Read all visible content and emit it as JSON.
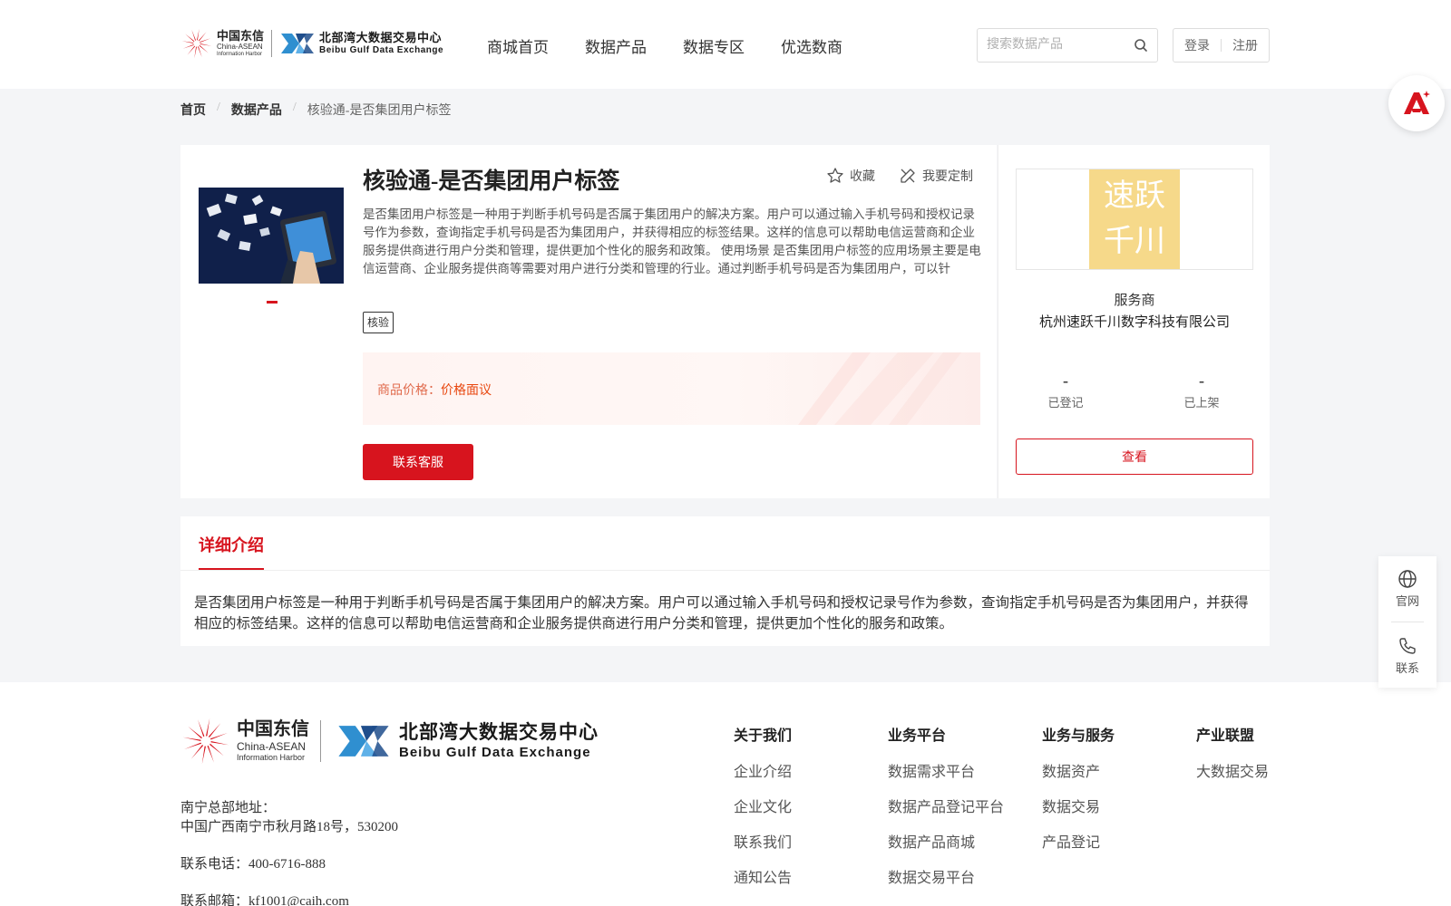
{
  "brand": {
    "ca_cn": "中国东信",
    "ca_en1": "China-ASEAN",
    "ca_en2": "Information Harbor",
    "bx_cn": "北部湾大数据交易中心",
    "bx_en": "Beibu Gulf Data Exchange",
    "primary_color": "#d7141e",
    "accent_blue": "#2f8fd0"
  },
  "nav": {
    "items": [
      "商城首页",
      "数据产品",
      "数据专区",
      "优选数商"
    ]
  },
  "search": {
    "placeholder": "搜索数据产品",
    "icon": "search-icon"
  },
  "auth": {
    "login": "登录",
    "register": "注册"
  },
  "breadcrumb": {
    "home": "首页",
    "category": "数据产品",
    "current": "核验通-是否集团用户标签"
  },
  "product": {
    "title": "核验通-是否集团用户标签",
    "favorite_label": "收藏",
    "customize_label": "我要定制",
    "description": "是否集团用户标签是一种用于判断手机号码是否属于集团用户的解决方案。用户可以通过输入手机号码和授权记录号作为参数，查询指定手机号码是否为集团用户，并获得相应的标签结果。这样的信息可以帮助电信运营商和企业服务提供商进行用户分类和管理，提供更加个性化的服务和政策。 使用场景 是否集团用户标签的应用场景主要是电信运营商、企业服务提供商等需要对用户进行分类和管理的行业。通过判断手机号码是否为集团用户，可以针",
    "tag": "核验",
    "price_label": "商品价格：",
    "price_value": "价格面议",
    "contact_button": "联系客服"
  },
  "provider": {
    "logo_text_line1": "速跃",
    "logo_text_line2": "千川",
    "label": "服务商",
    "name": "杭州速跃千川数字科技有限公司",
    "stats": [
      {
        "value": "-",
        "label": "已登记"
      },
      {
        "value": "-",
        "label": "已上架"
      }
    ],
    "view_button": "查看"
  },
  "detail": {
    "tab": "详细介绍",
    "text": "是否集团用户标签是一种用于判断手机号码是否属于集团用户的解决方案。用户可以通过输入手机号码和授权记录号作为参数，查询指定手机号码是否为集团用户，并获得相应的标签结果。这样的信息可以帮助电信运营商和企业服务提供商进行用户分类和管理，提供更加个性化的服务和政策。"
  },
  "side_widget": {
    "items": [
      {
        "label": "官网",
        "icon": "globe-icon"
      },
      {
        "label": "联系",
        "icon": "phone-icon"
      }
    ]
  },
  "footer": {
    "address_label": "南宁总部地址：",
    "address": "中国广西南宁市秋月路18号，530200",
    "phone": "联系电话：400-6716-888",
    "email": "联系邮箱：kf1001@caih.com",
    "columns": [
      {
        "title": "关于我们",
        "items": [
          "企业介绍",
          "企业文化",
          "联系我们",
          "通知公告"
        ]
      },
      {
        "title": "业务平台",
        "items": [
          "数据需求平台",
          "数据产品登记平台",
          "数据产品商城",
          "数据交易平台"
        ]
      },
      {
        "title": "业务与服务",
        "items": [
          "数据资产",
          "数据交易",
          "产品登记"
        ]
      },
      {
        "title": "产业联盟",
        "items": [
          "大数据交易"
        ]
      }
    ]
  }
}
